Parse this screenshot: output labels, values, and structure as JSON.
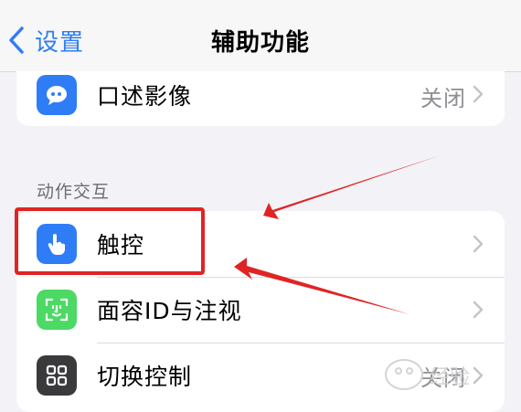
{
  "nav": {
    "back_label": "设置",
    "title": "辅助功能"
  },
  "top_card": {
    "label": "口述影像",
    "value": "关闭"
  },
  "section_header": "动作交互",
  "rows": [
    {
      "label": "触控",
      "value": ""
    },
    {
      "label": "面容ID与注视",
      "value": ""
    },
    {
      "label": "切换控制",
      "value": "关闭"
    }
  ],
  "colors": {
    "accent": "#2f7df6",
    "highlight": "#e02424",
    "background": "#f2f2f7"
  },
  "watermark": {
    "text": "经验"
  }
}
